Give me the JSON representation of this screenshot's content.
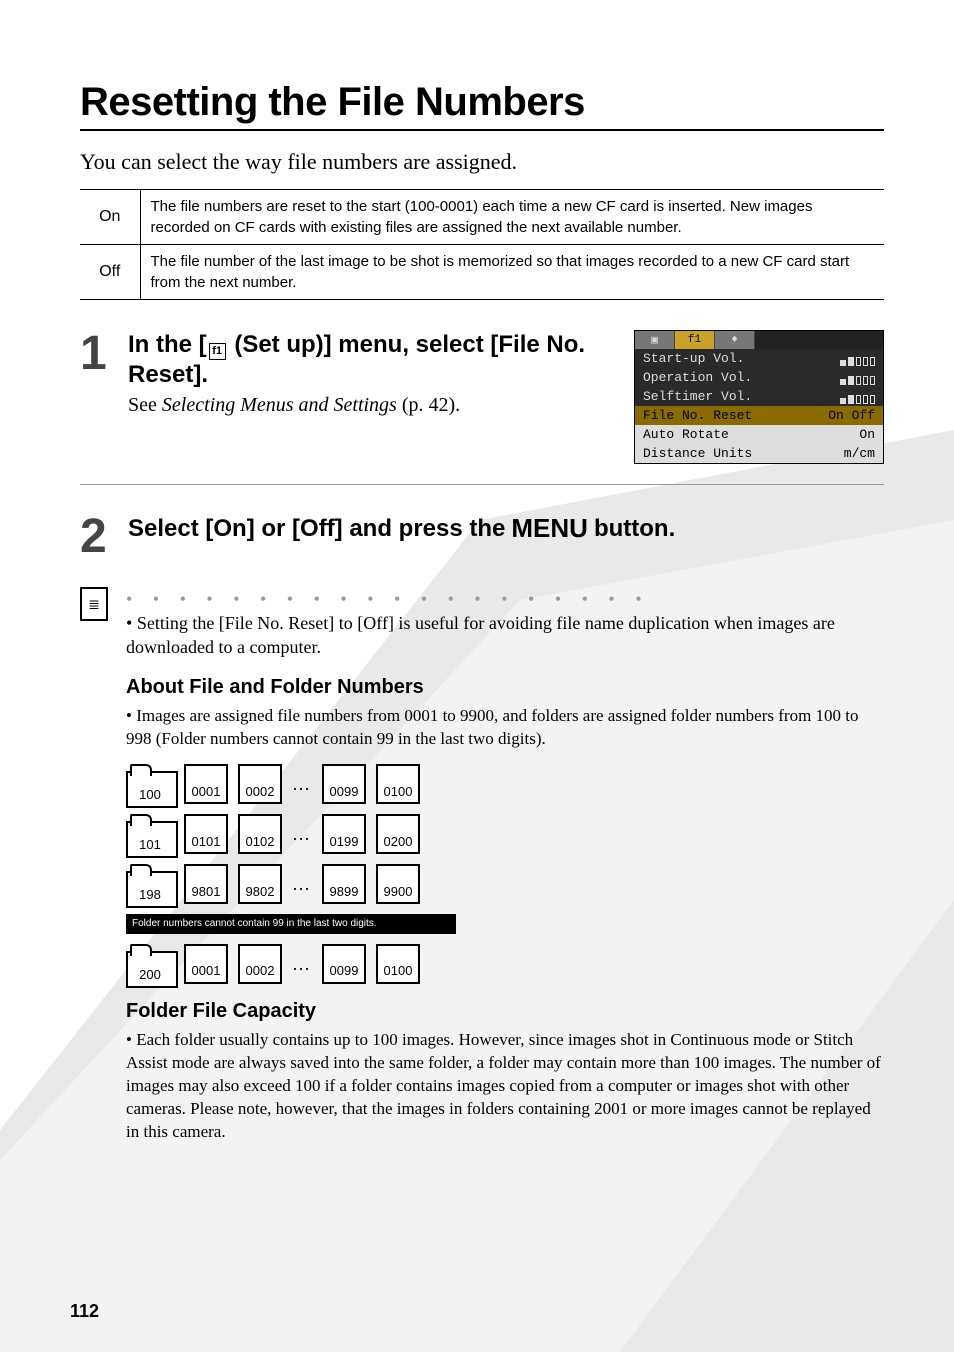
{
  "heading": "Resetting the File Numbers",
  "lead": "You can select the way file numbers are assigned.",
  "options": {
    "on": {
      "label": "On",
      "desc": "The file numbers are reset to the start (100-0001) each time a new CF card is inserted. New images recorded on CF cards with existing files are assigned the next available number."
    },
    "off": {
      "label": "Off",
      "desc": "The file number of the last image to be shot is memorized so that images recorded to a new CF card start from the next number."
    }
  },
  "steps": {
    "one": {
      "num": "1",
      "title_pre": "In the [",
      "title_icon": "f1",
      "title_mid": " (Set up)] menu, select [File No. Reset].",
      "subtitle_pre": "See ",
      "subtitle_em": "Selecting Menus and Settings",
      "subtitle_post": " (p. 42)."
    },
    "two": {
      "num": "2",
      "title_pre": "Select [On] or [Off] and press the ",
      "title_word": "MENU",
      "title_post": " button."
    }
  },
  "lcd": {
    "rows": [
      {
        "label": "Start-up Vol.",
        "val": ""
      },
      {
        "label": "Operation Vol.",
        "val": ""
      },
      {
        "label": "Selftimer Vol.",
        "val": ""
      },
      {
        "label": "File No. Reset",
        "val": "On  Off"
      },
      {
        "label": "Auto Rotate",
        "val": "On"
      },
      {
        "label": "Distance Units",
        "val": "m/cm"
      }
    ],
    "tab_current": "f1"
  },
  "note": {
    "bullet": "Setting the [File No. Reset] to [Off] is useful for avoiding file name duplication when images are downloaded to a computer."
  },
  "about_heading": "About File and Folder Numbers",
  "about_text": "Images are assigned file numbers from 0001 to 9900, and folders are assigned folder numbers from 100 to 998 (Folder numbers cannot contain 99 in the last two digits).",
  "diagram": {
    "rows": [
      {
        "folder": "100",
        "files": [
          "0001",
          "0002"
        ],
        "ell": "…",
        "files2": [
          "0099",
          "0100"
        ]
      },
      {
        "folder": "101",
        "files": [
          "0101",
          "0102"
        ],
        "ell": "…",
        "files2": [
          "0199",
          "0200"
        ]
      },
      {
        "folder": "198",
        "files": [
          "9801",
          "9802"
        ],
        "ell": "…",
        "files2": [
          "9899",
          "9900"
        ]
      },
      {
        "folder": "200",
        "files": [
          "0001",
          "0002"
        ],
        "ell": "…",
        "files2": [
          "0099",
          "0100"
        ]
      }
    ],
    "caption": "Folder numbers cannot contain 99 in the last two digits."
  },
  "capacity_heading": "Folder File Capacity",
  "capacity_text": "Each folder usually contains up to 100 images. However, since images shot in Continuous mode or Stitch Assist mode are always saved into the same folder, a folder may contain more than 100 images. The number of images may also exceed 100 if a folder contains images copied from a computer or images shot with other cameras. Please note, however, that the images in folders containing 2001 or more images cannot be replayed in this camera.",
  "pagenum": "112"
}
